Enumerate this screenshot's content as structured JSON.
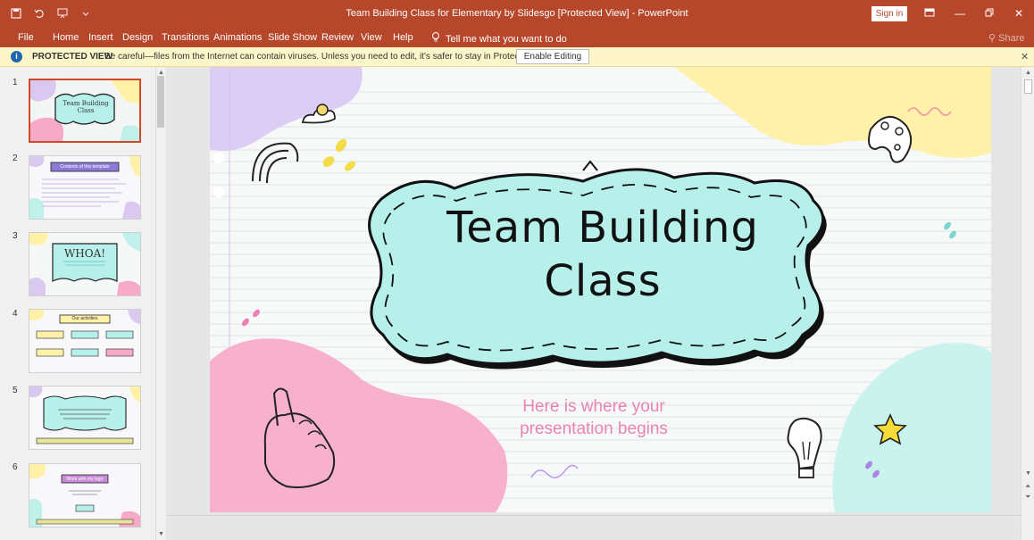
{
  "app": {
    "title": "Team Building Class for Elementary by Slidesgo [Protected View]  -  PowerPoint",
    "signin": "Sign in",
    "brand_color": "#b7472a"
  },
  "qat": {
    "save_icon": "save-icon",
    "undo_icon": "undo-icon",
    "present_icon": "present-icon",
    "customize_icon": "customize-icon"
  },
  "ribbon": {
    "tabs": [
      "File",
      "Home",
      "Insert",
      "Design",
      "Transitions",
      "Animations",
      "Slide Show",
      "Review",
      "View",
      "Help"
    ],
    "tellme": "Tell me what you want to do",
    "share": "Share"
  },
  "protected": {
    "title": "PROTECTED VIEW",
    "message": "Be careful—files from the Internet can contain viruses. Unless you need to edit, it's safer to stay in Protected View.",
    "enable_label": "Enable Editing"
  },
  "thumbs": [
    {
      "num": "1",
      "label": "Team Building Class"
    },
    {
      "num": "2",
      "label": "Contents of this template"
    },
    {
      "num": "3",
      "label": "WHOA!"
    },
    {
      "num": "4",
      "label": "Our activities"
    },
    {
      "num": "5",
      "label": ""
    },
    {
      "num": "6",
      "label": "Work with my logo"
    }
  ],
  "slide": {
    "title_line1": "Team Building",
    "title_line2": "Class",
    "subtitle_line1": "Here is where your",
    "subtitle_line2": "presentation begins",
    "frame_color": "#b7f0eb",
    "subtitle_color": "#e984b2"
  }
}
